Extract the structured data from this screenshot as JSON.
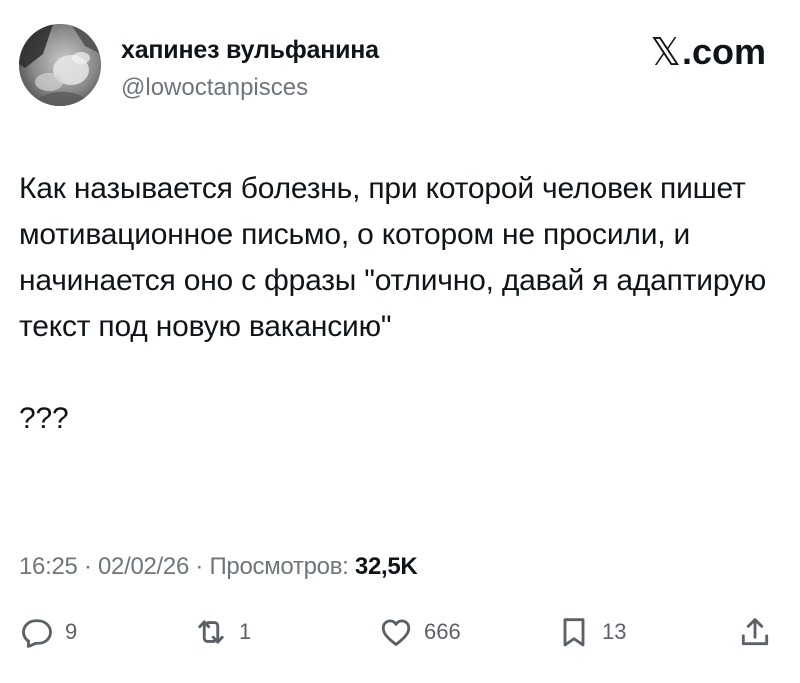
{
  "author": {
    "display_name": "хапинез вульфанина",
    "handle": "@lowoctanpisces"
  },
  "brand": {
    "label": ".com"
  },
  "tweet": {
    "paragraphs": [
      "Как называется болезнь, при которой человек пишет мотивационное письмо, о котором не просили, и начинается оно с фразы \"отлично, давай я адаптирую текст под новую вакансию\"",
      "???"
    ],
    "time": "16:25",
    "date": "02/02/26",
    "views_label": "Просмотров:",
    "views_count": "32,5K"
  },
  "actions": {
    "replies": "9",
    "reposts": "1",
    "likes": "666",
    "bookmarks": "13"
  },
  "icons": {
    "reply": "reply-icon",
    "repost": "repost-icon",
    "like": "like-icon",
    "bookmark": "bookmark-icon",
    "share": "share-icon",
    "brand": "x-logo-icon"
  }
}
